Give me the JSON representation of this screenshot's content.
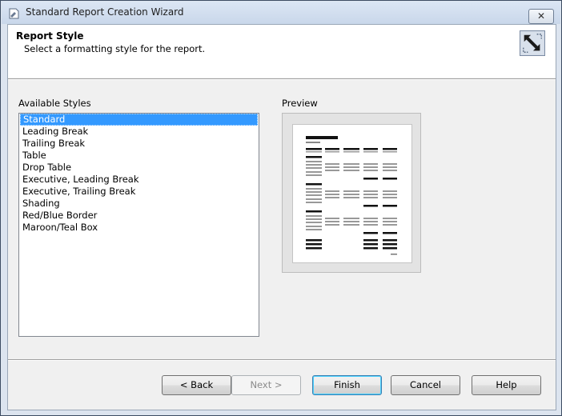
{
  "window": {
    "title": "Standard Report Creation Wizard",
    "close_glyph": "✕"
  },
  "header": {
    "title": "Report Style",
    "subtitle": "Select a formatting style for the report."
  },
  "styles": {
    "label": "Available Styles",
    "items": [
      "Standard",
      "Leading Break",
      "Trailing Break",
      "Table",
      "Drop Table",
      "Executive, Leading Break",
      "Executive, Trailing Break",
      "Shading",
      "Red/Blue Border",
      "Maroon/Teal Box"
    ],
    "selected": "Standard"
  },
  "preview": {
    "label": "Preview"
  },
  "buttons": {
    "back": "< Back",
    "next": "Next >",
    "finish": "Finish",
    "cancel": "Cancel",
    "help": "Help"
  },
  "colors": {
    "selection": "#3399ff",
    "title_bar": "#c9d7ea"
  }
}
